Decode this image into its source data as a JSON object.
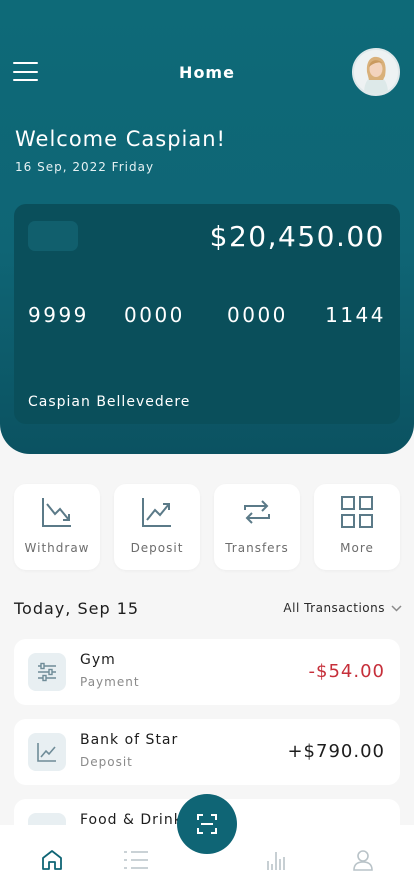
{
  "header": {
    "title": "Home",
    "menu_icon": "menu-icon",
    "avatar": "avatar"
  },
  "welcome": {
    "greeting": "Welcome Caspian!",
    "date": "16 Sep, 2022 Friday"
  },
  "card": {
    "balance": "$20,450.00",
    "number_groups": [
      "9999",
      "0000",
      "0000",
      "1144"
    ],
    "holder": "Caspian Bellevedere"
  },
  "actions": [
    {
      "label": "Withdraw",
      "icon": "chart-down-icon"
    },
    {
      "label": "Deposit",
      "icon": "chart-up-icon"
    },
    {
      "label": "Transfers",
      "icon": "transfer-icon"
    },
    {
      "label": "More",
      "icon": "grid-icon"
    }
  ],
  "transactions_section": {
    "title": "Today, Sep 15",
    "filter": "All Transactions"
  },
  "transactions": [
    {
      "name": "Gym",
      "category": "Payment",
      "amount": "-$54.00",
      "icon": "equalizer-icon"
    },
    {
      "name": "Bank of Star",
      "category": "Deposit",
      "amount": "+$790.00",
      "icon": "chart-up-icon"
    },
    {
      "name": "Food & Drink",
      "category": "",
      "amount": "",
      "icon": "food-icon"
    }
  ],
  "tabbar": {
    "items": [
      "home-icon",
      "list-icon",
      "scan-icon",
      "stats-icon",
      "profile-icon"
    ]
  },
  "colors": {
    "primary": "#0f6575",
    "card": "#0a4f5b",
    "negative": "#c62f3a",
    "background": "#f6f6f6"
  }
}
